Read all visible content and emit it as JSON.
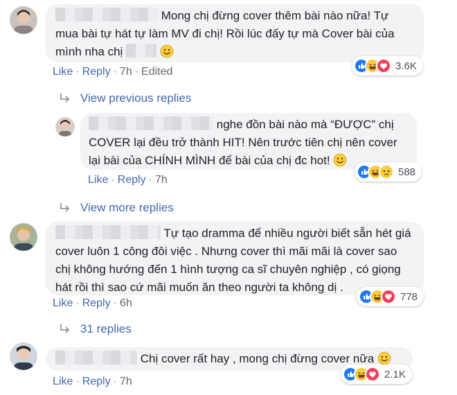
{
  "comments": [
    {
      "text_before": "Mong chị đừng cover thêm bài nào nữa! Tự mua bài tự hát tự làm MV đi chị! Rồi lúc đấy tự mà Cover bài của mình nha chị",
      "like": "Like",
      "reply": "Reply",
      "time": "7h",
      "edited": "Edited",
      "reaction_count": "3.6K",
      "reactions": [
        "like-icon",
        "haha-icon",
        "love-icon"
      ]
    },
    {
      "text": "nghe đồn bài nào mà “ĐƯỢC” chị COVER lại đều trở thành HIT! Nên trước tiên chị nên cover lại bài của CHÍNH MÌNH để bài của chị đc hot!",
      "like": "Like",
      "reply": "Reply",
      "time": "7h",
      "reaction_count": "588",
      "reactions": [
        "like-icon",
        "haha-icon",
        "sad-icon"
      ]
    },
    {
      "text": "Tự tạo dramma để nhiều người biết sẵn hét giá cover luôn 1 công đôi việc . Nhưng cover thì mãi mãi là cover sao chị không hướng đến 1 hình tượng ca sĩ chuyên nghiệp , có giọng hát rồi thì sao cứ mãi muốn ăn theo người ta không dị .",
      "like": "Like",
      "reply": "Reply",
      "time": "6h",
      "reaction_count": "778",
      "reactions": [
        "like-icon",
        "haha-icon",
        "love-icon"
      ]
    },
    {
      "text": "Chị cover rất hay , mong chị đừng cover nữa",
      "like": "Like",
      "reply": "Reply",
      "time": "7h",
      "reaction_count": "2.1K",
      "reactions": [
        "like-icon",
        "haha-icon",
        "love-icon"
      ]
    }
  ],
  "links": {
    "view_previous": "View previous replies",
    "view_more": "View more replies",
    "replies_31": "31 replies"
  },
  "colors": {
    "link": "#4267b2",
    "bubble": "#f2f3f5",
    "like_blue": "#2078f4",
    "love_red": "#f33e58",
    "haha_yellow": "#fbcd3a"
  }
}
